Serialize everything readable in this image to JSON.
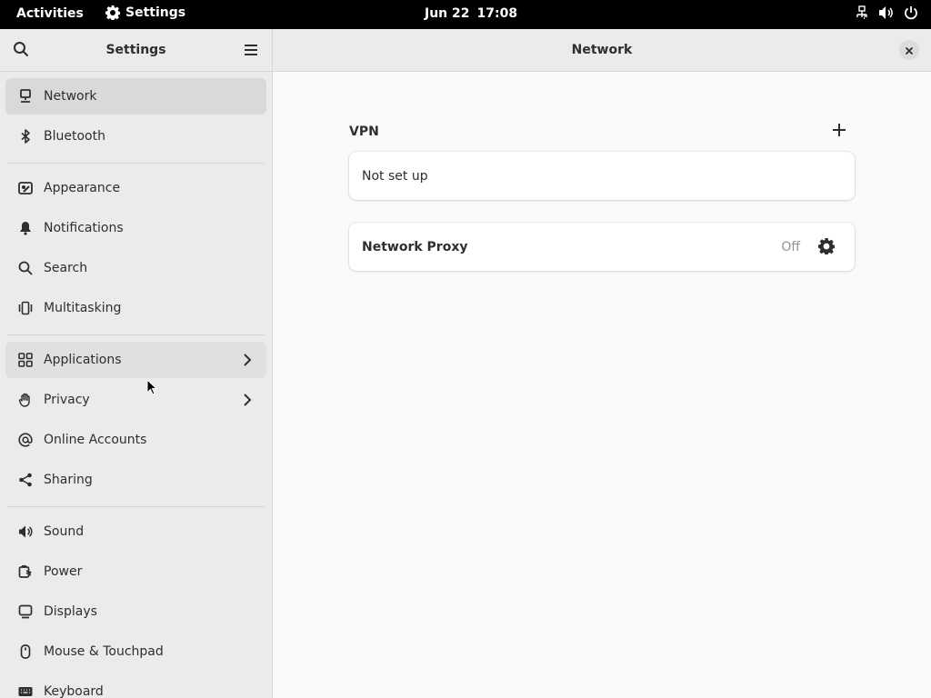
{
  "topbar": {
    "activities": "Activities",
    "app_name": "Settings",
    "date": "Jun 22",
    "time": "17:08",
    "tray_icons": [
      "network-wired-icon",
      "volume-icon",
      "power-icon"
    ]
  },
  "sidebar": {
    "title": "Settings",
    "items": [
      {
        "label": "Network",
        "icon": "network-icon",
        "selected": true
      },
      {
        "label": "Bluetooth",
        "icon": "bluetooth-icon"
      },
      {
        "label": "Appearance",
        "icon": "appearance-icon"
      },
      {
        "label": "Notifications",
        "icon": "bell-icon"
      },
      {
        "label": "Search",
        "icon": "search-icon"
      },
      {
        "label": "Multitasking",
        "icon": "multitasking-icon"
      },
      {
        "label": "Applications",
        "icon": "grid-icon",
        "has_submenu": true
      },
      {
        "label": "Privacy",
        "icon": "hand-icon",
        "has_submenu": true
      },
      {
        "label": "Online Accounts",
        "icon": "at-icon"
      },
      {
        "label": "Sharing",
        "icon": "share-icon"
      },
      {
        "label": "Sound",
        "icon": "speaker-icon"
      },
      {
        "label": "Power",
        "icon": "battery-icon"
      },
      {
        "label": "Displays",
        "icon": "display-icon"
      },
      {
        "label": "Mouse & Touchpad",
        "icon": "mouse-icon"
      },
      {
        "label": "Keyboard",
        "icon": "keyboard-icon"
      }
    ]
  },
  "main": {
    "title": "Network",
    "vpn": {
      "title": "VPN",
      "status": "Not set up"
    },
    "proxy": {
      "label": "Network Proxy",
      "status": "Off"
    }
  },
  "colors": {
    "topbar_bg": "#000000",
    "sidebar_bg": "#ebebeb",
    "selected_bg": "#d9d9d9",
    "content_bg": "#fafafa",
    "card_bg": "#ffffff"
  }
}
